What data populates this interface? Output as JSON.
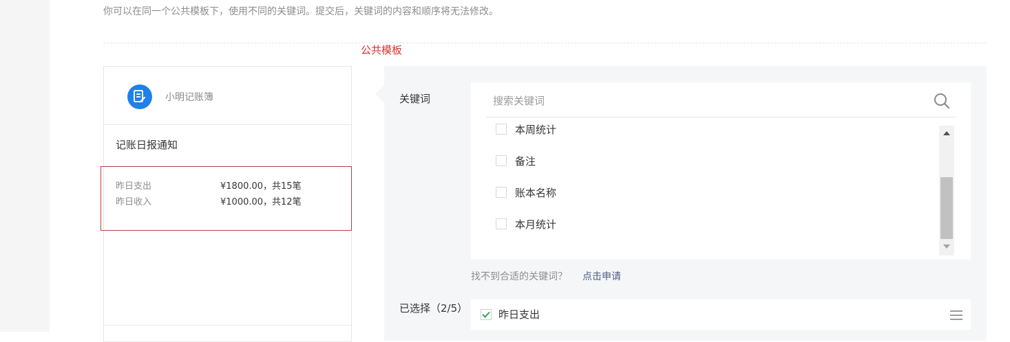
{
  "page": {
    "hint": "你可以在同一个公共模板下，使用不同的关键词。提交后，关键词的内容和顺序将无法修改。",
    "section_title": "公共模板"
  },
  "preview": {
    "account_name": "小明记账簿",
    "logo_icon": "notebook-edit-icon",
    "message_title": "记账日报通知",
    "rows": [
      {
        "label": "昨日支出",
        "value": "¥1800.00，共15笔"
      },
      {
        "label": "昨日收入",
        "value": "¥1000.00，共12笔"
      }
    ]
  },
  "keywords": {
    "label": "关键词",
    "search_placeholder": "搜索关键词",
    "search_icon": "search-icon",
    "options": [
      {
        "label": "本周统计",
        "checked": false
      },
      {
        "label": "备注",
        "checked": false
      },
      {
        "label": "账本名称",
        "checked": false
      },
      {
        "label": "本月统计",
        "checked": false
      }
    ],
    "not_found_text": "找不到合适的关键词？",
    "apply_link": "点击申请"
  },
  "selected": {
    "label": "已选择（2/5）",
    "items": [
      {
        "label": "昨日支出",
        "checked": true
      }
    ],
    "drag_icon": "drag-handle-icon"
  },
  "colors": {
    "accent_red": "#d8342c",
    "logo_blue": "#1d81e8",
    "check_green": "#2ea44f",
    "link": "#4a5d80"
  }
}
